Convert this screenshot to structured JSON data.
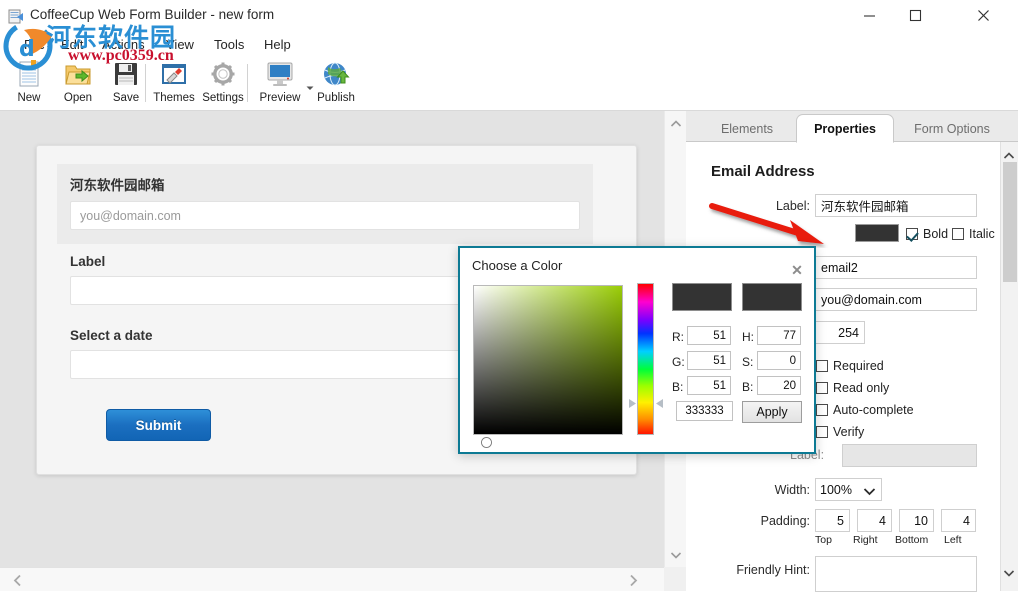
{
  "window": {
    "title": "CoffeeCup Web Form Builder - new form",
    "app_icon": "window-app-icon",
    "minimize_label": "Minimize",
    "maximize_label": "Maximize",
    "close_label": "Close"
  },
  "menubar": {
    "items": [
      {
        "label": "File"
      },
      {
        "label": "Edit"
      },
      {
        "label": "Actions"
      },
      {
        "label": "View"
      },
      {
        "label": "Tools"
      },
      {
        "label": "Help"
      }
    ]
  },
  "toolbar": {
    "items": [
      {
        "label": "New",
        "icon": "new-document-icon"
      },
      {
        "label": "Open",
        "icon": "open-folder-icon"
      },
      {
        "label": "Save",
        "icon": "floppy-disk-icon"
      },
      {
        "label": "Themes",
        "icon": "themes-brush-icon"
      },
      {
        "label": "Settings",
        "icon": "gear-icon"
      },
      {
        "label": "Preview",
        "icon": "monitor-icon"
      },
      {
        "label": "Publish",
        "icon": "globe-upload-icon"
      }
    ],
    "preview_dropdown_icon": "chevron-down-icon"
  },
  "canvas": {
    "fields": [
      {
        "label": "河东软件园邮箱",
        "value": "",
        "placeholder": "you@domain.com",
        "selected": true
      },
      {
        "label": "Label",
        "value": "",
        "placeholder": "",
        "selected": false
      },
      {
        "label": "Select a date",
        "value": "",
        "placeholder": "",
        "selected": false
      }
    ],
    "submit_label": "Submit",
    "scroll_up_icon": "chevron-up-icon",
    "scroll_down_icon": "chevron-down-icon",
    "scroll_left_icon": "chevron-left-icon",
    "scroll_right_icon": "chevron-right-icon"
  },
  "properties_panel": {
    "tabs": [
      {
        "label": "Elements",
        "active": false
      },
      {
        "label": "Properties",
        "active": true
      },
      {
        "label": "Form Options",
        "active": false
      }
    ],
    "title": "Email Address",
    "label_field": {
      "caption": "Label:",
      "value": "河东软件园邮箱"
    },
    "font_color": "#333333",
    "bold": {
      "label": "Bold",
      "checked": true
    },
    "italic": {
      "label": "Italic",
      "checked": false
    },
    "name_field": {
      "value": "email2"
    },
    "placeholder_field": {
      "value": "you@domain.com"
    },
    "maxlength_field": {
      "value": "254"
    },
    "checkboxes": [
      {
        "label": "Required",
        "checked": false
      },
      {
        "label": "Read only",
        "checked": false
      },
      {
        "label": "Auto-complete",
        "checked": false
      },
      {
        "label": "Verify",
        "checked": false
      }
    ],
    "verify_label": {
      "caption": "Label:",
      "value": "",
      "disabled": true
    },
    "width": {
      "caption": "Width:",
      "value": "100%",
      "icon": "chevron-down-icon"
    },
    "padding": {
      "caption": "Padding:",
      "top": {
        "value": "5",
        "caption": "Top"
      },
      "right": {
        "value": "4",
        "caption": "Right"
      },
      "bottom": {
        "value": "10",
        "caption": "Bottom"
      },
      "left": {
        "value": "4",
        "caption": "Left"
      }
    },
    "friendly_hint": {
      "caption": "Friendly Hint:",
      "value": ""
    },
    "scroll_up_icon": "chevron-up-icon",
    "scroll_down_icon": "chevron-down-icon"
  },
  "color_dialog": {
    "title": "Choose a Color",
    "close_icon": "close-icon",
    "new_swatch": "#333333",
    "old_swatch": "#333333",
    "rgb": {
      "r": {
        "caption": "R:",
        "value": "51"
      },
      "g": {
        "caption": "G:",
        "value": "51"
      },
      "b": {
        "caption": "B:",
        "value": "51"
      }
    },
    "hsb": {
      "h": {
        "caption": "H:",
        "value": "77"
      },
      "s": {
        "caption": "S:",
        "value": "0"
      },
      "b": {
        "caption": "B:",
        "value": "20"
      }
    },
    "hex": "333333",
    "apply_label": "Apply",
    "border_color": "#0d7a94",
    "hue_marker_left_icon": "triangle-right-icon",
    "hue_marker_right_icon": "triangle-left-icon"
  },
  "annotation": {
    "arrow_color": "#e81b0f",
    "arrow_name": "red-pointer-arrow"
  },
  "watermark": {
    "site_cn": "河东软件园",
    "site_url": "www.pc0359.cn"
  }
}
